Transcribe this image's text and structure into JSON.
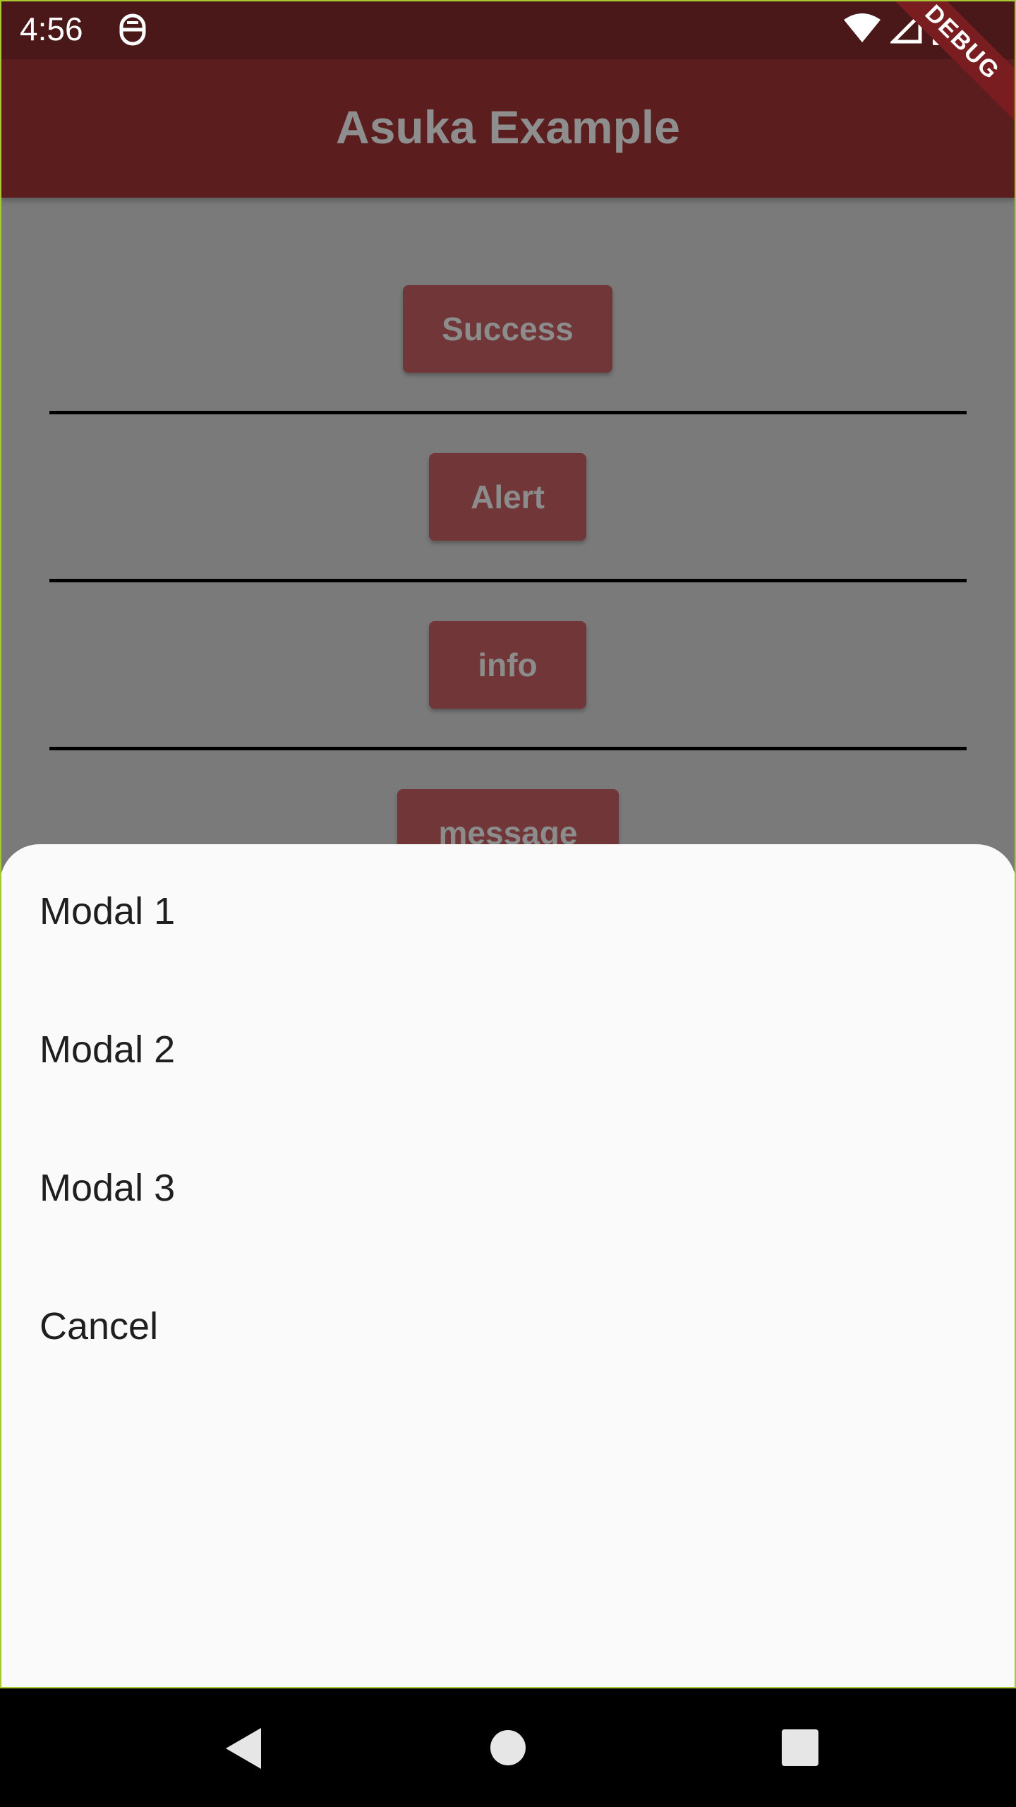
{
  "status_bar": {
    "time": "4:56",
    "icons": [
      "notification-icon",
      "wifi-icon",
      "cell-signal-icon",
      "battery-icon"
    ]
  },
  "app_bar": {
    "title": "Asuka Example"
  },
  "debug_banner": {
    "label": "DEBUG"
  },
  "buttons": [
    {
      "label": "Success"
    },
    {
      "label": "Alert"
    },
    {
      "label": "info"
    },
    {
      "label": "message"
    }
  ],
  "bottom_sheet": {
    "items": [
      {
        "label": "Modal 1"
      },
      {
        "label": "Modal 2"
      },
      {
        "label": "Modal 3"
      },
      {
        "label": "Cancel"
      }
    ]
  },
  "nav_bar": {
    "buttons": [
      "back-icon",
      "home-icon",
      "recents-icon"
    ]
  },
  "colors": {
    "status_bar": "#4a1818",
    "app_bar": "#5c1d1f",
    "button": "#713637",
    "scrim": "#7a7a7a",
    "sheet": "#fafafa"
  }
}
